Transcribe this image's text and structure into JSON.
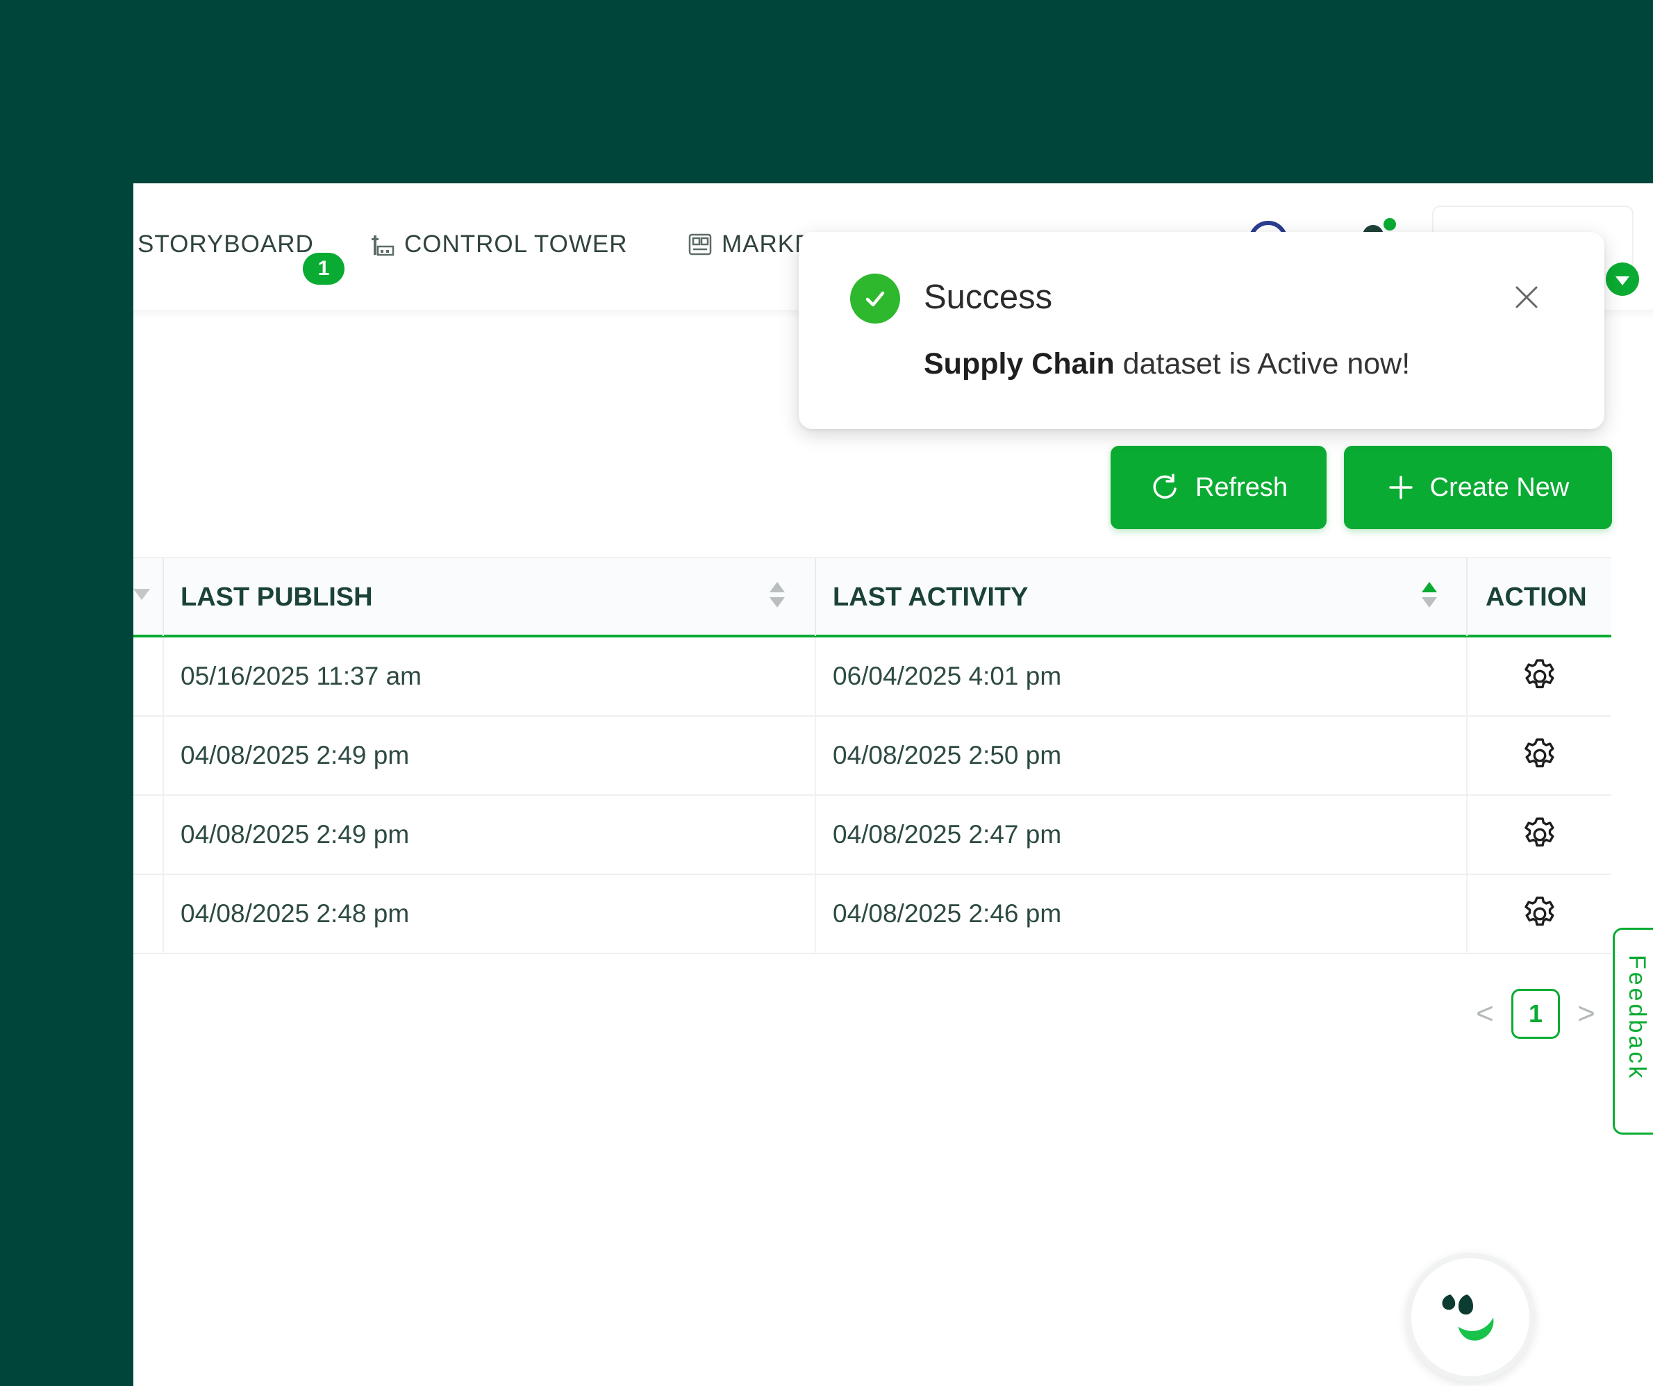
{
  "nav": {
    "storyboard": "STORYBOARD",
    "storyboard_badge": "1",
    "control_tower": "CONTROL TOWER",
    "market": "MARKET"
  },
  "toast": {
    "title": "Success",
    "message_bold": "Supply Chain",
    "message_rest": " dataset is Active now!",
    "icon": "check-circle-icon",
    "close_icon": "close-icon"
  },
  "actions": {
    "refresh": "Refresh",
    "create_new": "Create New"
  },
  "table": {
    "headers": {
      "last_publish": "LAST PUBLISH",
      "last_activity": "LAST ACTIVITY",
      "action": "ACTION"
    },
    "sort": {
      "last_activity": "ascending"
    },
    "rows": [
      {
        "last_publish": "05/16/2025 11:37 am",
        "last_activity": "06/04/2025 4:01 pm",
        "action_icon": "gear-icon"
      },
      {
        "last_publish": "04/08/2025 2:49 pm",
        "last_activity": "04/08/2025 2:50 pm",
        "action_icon": "gear-icon"
      },
      {
        "last_publish": "04/08/2025 2:49 pm",
        "last_activity": "04/08/2025 2:47 pm",
        "action_icon": "gear-icon"
      },
      {
        "last_publish": "04/08/2025 2:48 pm",
        "last_activity": "04/08/2025 2:46 pm",
        "action_icon": "gear-icon"
      }
    ]
  },
  "pagination": {
    "current_page": "1",
    "prev": "<",
    "next": ">"
  },
  "feedback": {
    "label": "Feedback"
  },
  "colors": {
    "background": "#00453a",
    "accent": "#0aab32",
    "header_text": "#1b4238"
  }
}
